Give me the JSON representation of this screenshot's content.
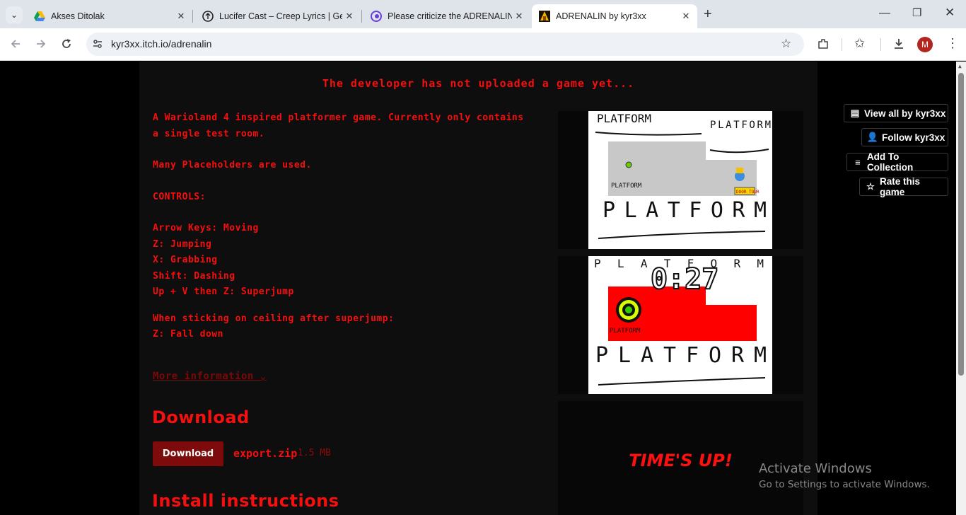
{
  "tabs": [
    {
      "title": "Akses Ditolak",
      "icon": "drive-icon"
    },
    {
      "title": "Lucifer Cast – Creep Lyrics | Gen",
      "icon": "genius-icon"
    },
    {
      "title": "Please criticize the ADRENALIN",
      "icon": "site-icon"
    },
    {
      "title": "ADRENALIN by kyr3xx",
      "icon": "itch-game-icon"
    }
  ],
  "address": "kyr3xx.itch.io/adrenalin",
  "profile_initial": "M",
  "page": {
    "no_game_notice": "The developer has not uploaded a game yet...",
    "description": [
      "A Warioland 4 inspired platformer game. Currently only contains",
      "a single test room."
    ],
    "placeholders": "Many Placeholders are used.",
    "controls_heading": "CONTROLS:",
    "controls": [
      "Arrow Keys: Moving",
      "Z: Jumping",
      "X: Grabbing",
      "Shift: Dashing",
      "Up + V then Z: Superjump"
    ],
    "ceiling_heading": "When sticking on ceiling after superjump:",
    "ceiling_control": "Z: Fall down",
    "more_info": "More information",
    "download_heading": "Download",
    "download_button": "Download",
    "file_name": "export.zip",
    "file_size": "1.5 MB",
    "install_heading": "Install instructions"
  },
  "screenshots": {
    "platform_text": "PLATFORM",
    "door_text": "DOOR TOUR",
    "timer": "0:27",
    "times_up": "TIME'S UP!"
  },
  "side_buttons": {
    "view_all": "View all by kyr3xx",
    "follow": "Follow kyr3xx",
    "add_collection": "Add To Collection",
    "rate": "Rate this game"
  },
  "watermark": {
    "title": "Activate Windows",
    "subtitle": "Go to Settings to activate Windows."
  }
}
